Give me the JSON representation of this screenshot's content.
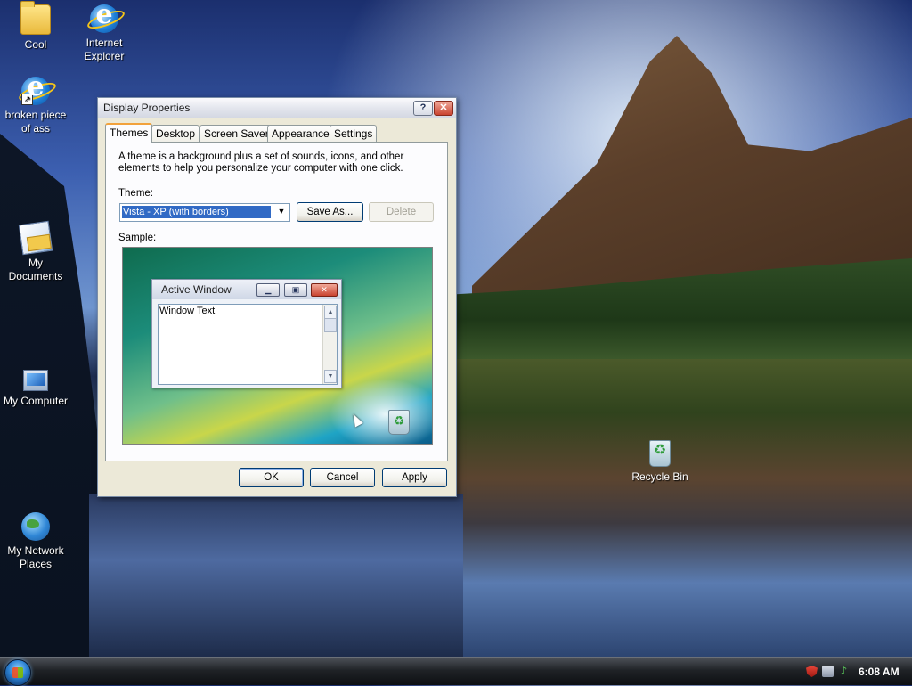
{
  "desktop": {
    "icons": [
      {
        "label": "Cool"
      },
      {
        "label": "Internet Explorer"
      },
      {
        "label": "broken piece of ass"
      },
      {
        "label": "My Documents"
      },
      {
        "label": "My Computer"
      },
      {
        "label": "My Network Places"
      },
      {
        "label": "Recycle Bin"
      }
    ]
  },
  "dialog": {
    "title": "Display Properties",
    "help_label": "?",
    "close_label": "✕",
    "tabs": [
      {
        "label": "Themes",
        "active": true
      },
      {
        "label": "Desktop"
      },
      {
        "label": "Screen Saver"
      },
      {
        "label": "Appearance"
      },
      {
        "label": "Settings"
      }
    ],
    "description": "A theme is a background plus a set of sounds, icons, and other elements to help you personalize your computer with one click.",
    "theme_label": "Theme:",
    "theme_value": "Vista - XP (with borders)",
    "save_as_label": "Save As...",
    "delete_label": "Delete",
    "sample_label": "Sample:",
    "sample": {
      "window_title": "Active Window",
      "window_text": "Window Text"
    },
    "ok_label": "OK",
    "cancel_label": "Cancel",
    "apply_label": "Apply"
  },
  "taskbar": {
    "clock": "6:08 AM"
  }
}
